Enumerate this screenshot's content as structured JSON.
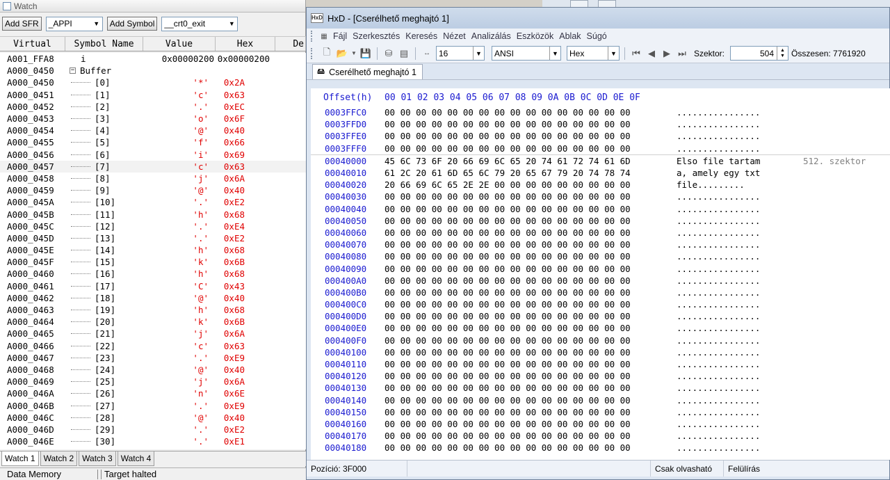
{
  "watch": {
    "title": "Watch",
    "add_sfr_label": "Add SFR",
    "sfr_combo": "_APPI",
    "add_symbol_label": "Add Symbol",
    "symbol_combo": "__crt0_exit",
    "columns": [
      "Virtual",
      "Symbol Name",
      "Value",
      "Hex",
      "De"
    ],
    "rows": [
      {
        "virt": "A001_FFA8",
        "sym": "i",
        "val": "0x00000200",
        "hex": "0x00000200",
        "kind": "plain"
      },
      {
        "virt": "A000_0450",
        "sym": "Buffer",
        "val": "",
        "hex": "",
        "kind": "parent"
      },
      {
        "virt": "A000_0450",
        "sym": "[0]",
        "val": "'*'",
        "hex": "0x2A",
        "kind": "child"
      },
      {
        "virt": "A000_0451",
        "sym": "[1]",
        "val": "'c'",
        "hex": "0x63",
        "kind": "child"
      },
      {
        "virt": "A000_0452",
        "sym": "[2]",
        "val": "'.'",
        "hex": "0xEC",
        "kind": "child"
      },
      {
        "virt": "A000_0453",
        "sym": "[3]",
        "val": "'o'",
        "hex": "0x6F",
        "kind": "child"
      },
      {
        "virt": "A000_0454",
        "sym": "[4]",
        "val": "'@'",
        "hex": "0x40",
        "kind": "child"
      },
      {
        "virt": "A000_0455",
        "sym": "[5]",
        "val": "'f'",
        "hex": "0x66",
        "kind": "child"
      },
      {
        "virt": "A000_0456",
        "sym": "[6]",
        "val": "'i'",
        "hex": "0x69",
        "kind": "child"
      },
      {
        "virt": "A000_0457",
        "sym": "[7]",
        "val": "'c'",
        "hex": "0x63",
        "kind": "child",
        "highlight": true
      },
      {
        "virt": "A000_0458",
        "sym": "[8]",
        "val": "'j'",
        "hex": "0x6A",
        "kind": "child"
      },
      {
        "virt": "A000_0459",
        "sym": "[9]",
        "val": "'@'",
        "hex": "0x40",
        "kind": "child"
      },
      {
        "virt": "A000_045A",
        "sym": "[10]",
        "val": "'.'",
        "hex": "0xE2",
        "kind": "child"
      },
      {
        "virt": "A000_045B",
        "sym": "[11]",
        "val": "'h'",
        "hex": "0x68",
        "kind": "child"
      },
      {
        "virt": "A000_045C",
        "sym": "[12]",
        "val": "'.'",
        "hex": "0xE4",
        "kind": "child"
      },
      {
        "virt": "A000_045D",
        "sym": "[13]",
        "val": "'.'",
        "hex": "0xE2",
        "kind": "child"
      },
      {
        "virt": "A000_045E",
        "sym": "[14]",
        "val": "'h'",
        "hex": "0x68",
        "kind": "child"
      },
      {
        "virt": "A000_045F",
        "sym": "[15]",
        "val": "'k'",
        "hex": "0x6B",
        "kind": "child"
      },
      {
        "virt": "A000_0460",
        "sym": "[16]",
        "val": "'h'",
        "hex": "0x68",
        "kind": "child"
      },
      {
        "virt": "A000_0461",
        "sym": "[17]",
        "val": "'C'",
        "hex": "0x43",
        "kind": "child"
      },
      {
        "virt": "A000_0462",
        "sym": "[18]",
        "val": "'@'",
        "hex": "0x40",
        "kind": "child"
      },
      {
        "virt": "A000_0463",
        "sym": "[19]",
        "val": "'h'",
        "hex": "0x68",
        "kind": "child"
      },
      {
        "virt": "A000_0464",
        "sym": "[20]",
        "val": "'k'",
        "hex": "0x6B",
        "kind": "child"
      },
      {
        "virt": "A000_0465",
        "sym": "[21]",
        "val": "'j'",
        "hex": "0x6A",
        "kind": "child"
      },
      {
        "virt": "A000_0466",
        "sym": "[22]",
        "val": "'c'",
        "hex": "0x63",
        "kind": "child"
      },
      {
        "virt": "A000_0467",
        "sym": "[23]",
        "val": "'.'",
        "hex": "0xE9",
        "kind": "child"
      },
      {
        "virt": "A000_0468",
        "sym": "[24]",
        "val": "'@'",
        "hex": "0x40",
        "kind": "child"
      },
      {
        "virt": "A000_0469",
        "sym": "[25]",
        "val": "'j'",
        "hex": "0x6A",
        "kind": "child"
      },
      {
        "virt": "A000_046A",
        "sym": "[26]",
        "val": "'n'",
        "hex": "0x6E",
        "kind": "child"
      },
      {
        "virt": "A000_046B",
        "sym": "[27]",
        "val": "'.'",
        "hex": "0xE9",
        "kind": "child"
      },
      {
        "virt": "A000_046C",
        "sym": "[28]",
        "val": "'@'",
        "hex": "0x40",
        "kind": "child"
      },
      {
        "virt": "A000_046D",
        "sym": "[29]",
        "val": "'.'",
        "hex": "0xE2",
        "kind": "child"
      },
      {
        "virt": "A000_046E",
        "sym": "[30]",
        "val": "'.'",
        "hex": "0xE1",
        "kind": "child"
      }
    ],
    "tabs": [
      "Watch 1",
      "Watch 2",
      "Watch 3",
      "Watch 4"
    ],
    "active_tab": 0,
    "bottom_left": "Data Memory",
    "bottom_right": "Target halted"
  },
  "hxd": {
    "title": "HxD - [Cserélhető meghajtó 1]",
    "logo_text": "HxD",
    "menu": [
      "Fájl",
      "Szerkesztés",
      "Keresés",
      "Nézet",
      "Analizálás",
      "Eszközök",
      "Ablak",
      "Súgó"
    ],
    "bytes_per_row": "16",
    "charset": "ANSI",
    "display_mode": "Hex",
    "sector_label": "Szektor:",
    "sector_value": "504",
    "total_label": "Összesen: 7761920",
    "doc_tab": "Cserélhető meghajtó 1",
    "offset_header": "Offset(h)",
    "col_header": "00 01 02 03 04 05 06 07 08 09 0A 0B 0C 0D 0E 0F",
    "rows": [
      {
        "off": "0003FFC0",
        "bytes": "00 00 00 00 00 00 00 00 00 00 00 00 00 00 00 00",
        "ascii": "................"
      },
      {
        "off": "0003FFD0",
        "bytes": "00 00 00 00 00 00 00 00 00 00 00 00 00 00 00 00",
        "ascii": "................"
      },
      {
        "off": "0003FFE0",
        "bytes": "00 00 00 00 00 00 00 00 00 00 00 00 00 00 00 00",
        "ascii": "................"
      },
      {
        "off": "0003FFF0",
        "bytes": "00 00 00 00 00 00 00 00 00 00 00 00 00 00 00 00",
        "ascii": "................",
        "sector_break": true
      },
      {
        "off": "00040000",
        "bytes": "45 6C 73 6F 20 66 69 6C 65 20 74 61 72 74 61 6D",
        "ascii": "Elso file tartam",
        "note": "512. szektor"
      },
      {
        "off": "00040010",
        "bytes": "61 2C 20 61 6D 65 6C 79 20 65 67 79 20 74 78 74",
        "ascii": "a, amely egy txt"
      },
      {
        "off": "00040020",
        "bytes": "20 66 69 6C 65 2E 2E 00 00 00 00 00 00 00 00 00",
        "ascii": " file........."
      },
      {
        "off": "00040030",
        "bytes": "00 00 00 00 00 00 00 00 00 00 00 00 00 00 00 00",
        "ascii": "................"
      },
      {
        "off": "00040040",
        "bytes": "00 00 00 00 00 00 00 00 00 00 00 00 00 00 00 00",
        "ascii": "................"
      },
      {
        "off": "00040050",
        "bytes": "00 00 00 00 00 00 00 00 00 00 00 00 00 00 00 00",
        "ascii": "................"
      },
      {
        "off": "00040060",
        "bytes": "00 00 00 00 00 00 00 00 00 00 00 00 00 00 00 00",
        "ascii": "................"
      },
      {
        "off": "00040070",
        "bytes": "00 00 00 00 00 00 00 00 00 00 00 00 00 00 00 00",
        "ascii": "................"
      },
      {
        "off": "00040080",
        "bytes": "00 00 00 00 00 00 00 00 00 00 00 00 00 00 00 00",
        "ascii": "................"
      },
      {
        "off": "00040090",
        "bytes": "00 00 00 00 00 00 00 00 00 00 00 00 00 00 00 00",
        "ascii": "................"
      },
      {
        "off": "000400A0",
        "bytes": "00 00 00 00 00 00 00 00 00 00 00 00 00 00 00 00",
        "ascii": "................"
      },
      {
        "off": "000400B0",
        "bytes": "00 00 00 00 00 00 00 00 00 00 00 00 00 00 00 00",
        "ascii": "................"
      },
      {
        "off": "000400C0",
        "bytes": "00 00 00 00 00 00 00 00 00 00 00 00 00 00 00 00",
        "ascii": "................"
      },
      {
        "off": "000400D0",
        "bytes": "00 00 00 00 00 00 00 00 00 00 00 00 00 00 00 00",
        "ascii": "................"
      },
      {
        "off": "000400E0",
        "bytes": "00 00 00 00 00 00 00 00 00 00 00 00 00 00 00 00",
        "ascii": "................"
      },
      {
        "off": "000400F0",
        "bytes": "00 00 00 00 00 00 00 00 00 00 00 00 00 00 00 00",
        "ascii": "................"
      },
      {
        "off": "00040100",
        "bytes": "00 00 00 00 00 00 00 00 00 00 00 00 00 00 00 00",
        "ascii": "................"
      },
      {
        "off": "00040110",
        "bytes": "00 00 00 00 00 00 00 00 00 00 00 00 00 00 00 00",
        "ascii": "................"
      },
      {
        "off": "00040120",
        "bytes": "00 00 00 00 00 00 00 00 00 00 00 00 00 00 00 00",
        "ascii": "................"
      },
      {
        "off": "00040130",
        "bytes": "00 00 00 00 00 00 00 00 00 00 00 00 00 00 00 00",
        "ascii": "................"
      },
      {
        "off": "00040140",
        "bytes": "00 00 00 00 00 00 00 00 00 00 00 00 00 00 00 00",
        "ascii": "................"
      },
      {
        "off": "00040150",
        "bytes": "00 00 00 00 00 00 00 00 00 00 00 00 00 00 00 00",
        "ascii": "................"
      },
      {
        "off": "00040160",
        "bytes": "00 00 00 00 00 00 00 00 00 00 00 00 00 00 00 00",
        "ascii": "................"
      },
      {
        "off": "00040170",
        "bytes": "00 00 00 00 00 00 00 00 00 00 00 00 00 00 00 00",
        "ascii": "................"
      },
      {
        "off": "00040180",
        "bytes": "00 00 00 00 00 00 00 00 00 00 00 00 00 00 00 00",
        "ascii": "................"
      }
    ],
    "status": {
      "position": "Pozíció: 3F000",
      "mode": "Csak olvasható",
      "overwrite": "Felülírás"
    }
  }
}
